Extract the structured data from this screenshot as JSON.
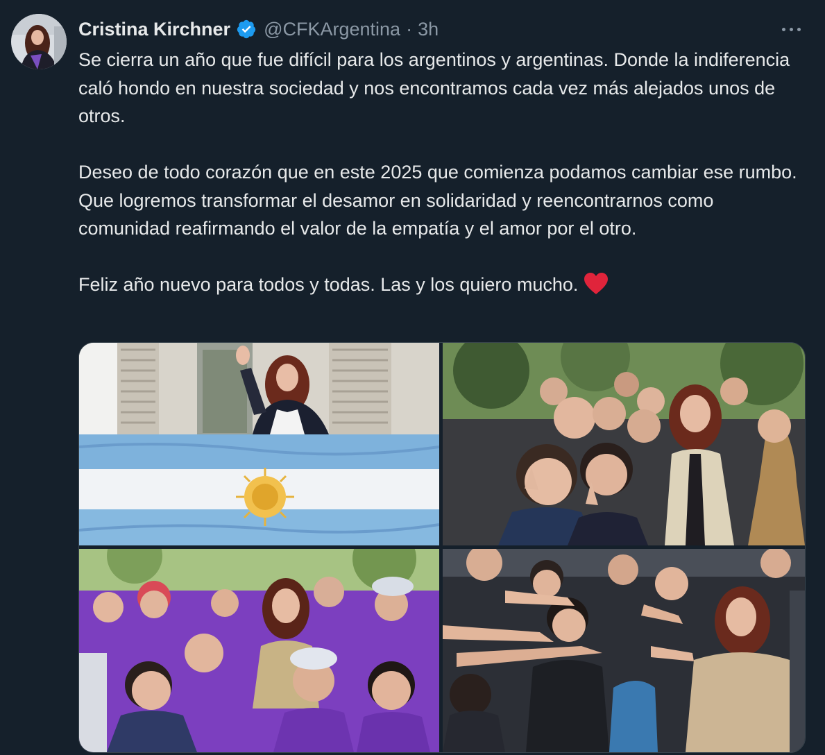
{
  "tweet": {
    "author": {
      "display_name": "Cristina Kirchner",
      "handle": "@CFKArgentina",
      "verified": true
    },
    "separator": "·",
    "timestamp": "3h",
    "paragraphs": [
      "Se cierra un año que fue difícil para los argentinos y argentinas. Donde la indiferencia caló hondo en nuestra sociedad y nos encontramos cada vez más alejados unos de otros.",
      "Deseo de todo corazón que en este 2025 que comienza podamos cambiar ese rumbo. Que logremos transformar el desamor en solidaridad y reencontrarnos como comunidad reafirmando el valor de la empatía y el amor por el otro.",
      "Feliz año nuevo para todos y todas. Las y los quiero mucho."
    ],
    "media_count": 4
  },
  "icons": {
    "verified": "verified-badge-icon",
    "more": "more-options-icon",
    "heart": "red-heart-emoji"
  },
  "colors": {
    "background": "#15202b",
    "text_primary": "#e7e9ea",
    "text_secondary": "#8b98a5",
    "verified_blue": "#1d9bf0",
    "heart_red": "#e0243b",
    "border": "#38444d"
  }
}
